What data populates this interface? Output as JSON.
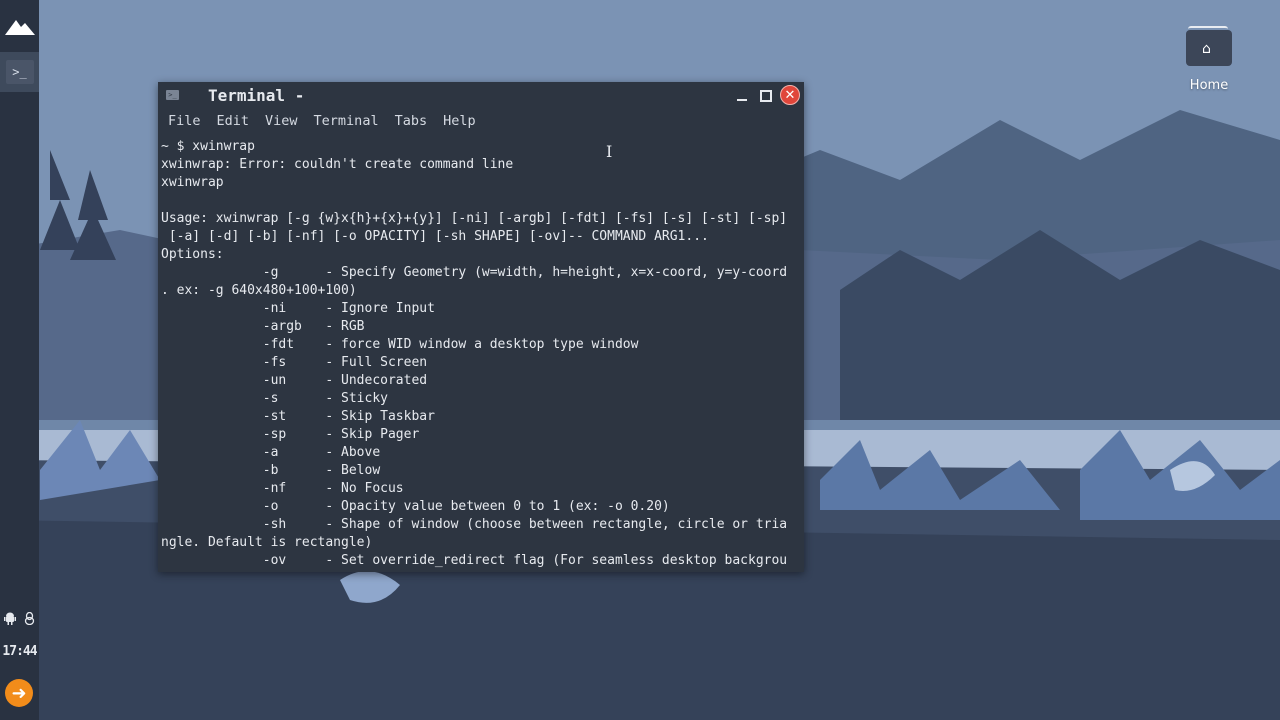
{
  "desktop": {
    "home_icon_label": "Home",
    "home_icon_name": "home-folder-icon"
  },
  "panel": {
    "app_menu_icon": "mountain-logo-icon",
    "terminal_launcher_label": ">_",
    "tray_icons": [
      "android-icon",
      "linux-penguin-icon"
    ],
    "clock": "17:44",
    "logout_icon": "arrow-right-icon",
    "logout_color": "#f28c1a"
  },
  "terminal": {
    "title": "Terminal -",
    "menu": [
      "File",
      "Edit",
      "View",
      "Terminal",
      "Tabs",
      "Help"
    ],
    "lines": [
      "~ $ xwinwrap",
      "xwinwrap: Error: couldn't create command line",
      "xwinwrap",
      "",
      "Usage: xwinwrap [-g {w}x{h}+{x}+{y}] [-ni] [-argb] [-fdt] [-fs] [-s] [-st] [-sp]",
      " [-a] [-d] [-b] [-nf] [-o OPACITY] [-sh SHAPE] [-ov]-- COMMAND ARG1...",
      "Options:",
      "             -g      - Specify Geometry (w=width, h=height, x=x-coord, y=y-coord",
      ". ex: -g 640x480+100+100)",
      "             -ni     - Ignore Input",
      "             -argb   - RGB",
      "             -fdt    - force WID window a desktop type window",
      "             -fs     - Full Screen",
      "             -un     - Undecorated",
      "             -s      - Sticky",
      "             -st     - Skip Taskbar",
      "             -sp     - Skip Pager",
      "             -a      - Above",
      "             -b      - Below",
      "             -nf     - No Focus",
      "             -o      - Opacity value between 0 to 1 (ex: -o 0.20)",
      "             -sh     - Shape of window (choose between rectangle, circle or tria",
      "ngle. Default is rectangle)",
      "             -ov     - Set override_redirect flag (For seamless desktop backgrou"
    ],
    "close_color": "#e0463b"
  }
}
